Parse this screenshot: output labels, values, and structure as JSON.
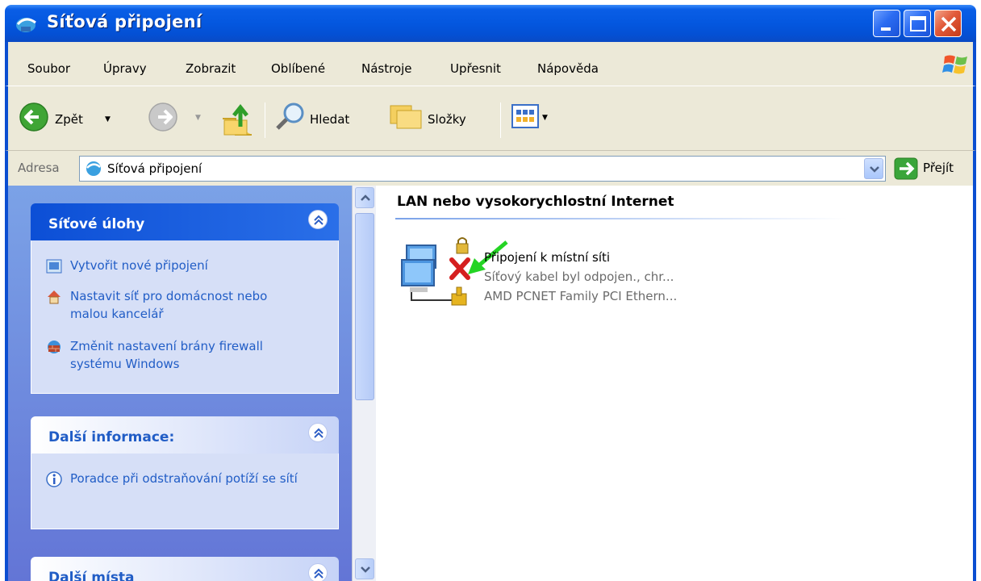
{
  "window": {
    "title": "Síťová připojení",
    "colors": {
      "titlebar": "#0457df",
      "close": "#e15a3a",
      "pane": "#7ba2e7",
      "link": "#215dc6"
    }
  },
  "menu": {
    "items": [
      "Soubor",
      "Úpravy",
      "Zobrazit",
      "Oblíbené",
      "Nástroje",
      "Upřesnit",
      "Nápověda"
    ]
  },
  "toolbar": {
    "back_label": "Zpět",
    "search_label": "Hledat",
    "folders_label": "Složky"
  },
  "address": {
    "label": "Adresa",
    "value": "Síťová připojení",
    "go_label": "Přejít"
  },
  "tasks_panel": {
    "title": "Síťové úlohy",
    "items": [
      {
        "icon": "new-connection-icon",
        "label": "Vytvořit nové připojení"
      },
      {
        "icon": "home-network-icon",
        "label": "Nastavit síť pro domácnost nebo malou kancelář"
      },
      {
        "icon": "firewall-icon",
        "label": "Změnit nastavení brány firewall systému Windows"
      }
    ]
  },
  "info_panel": {
    "title": "Další informace:",
    "items": [
      {
        "icon": "info-icon",
        "label": "Poradce při odstraňování potíží se sítí"
      }
    ]
  },
  "places_panel": {
    "title": "Další místa"
  },
  "content": {
    "group_title": "LAN nebo vysokorychlostní Internet",
    "connection": {
      "name": "Připojení k místní síti",
      "status": "Síťový kabel byl odpojen., chr...",
      "device": "AMD PCNET Family PCI Ethern..."
    }
  }
}
